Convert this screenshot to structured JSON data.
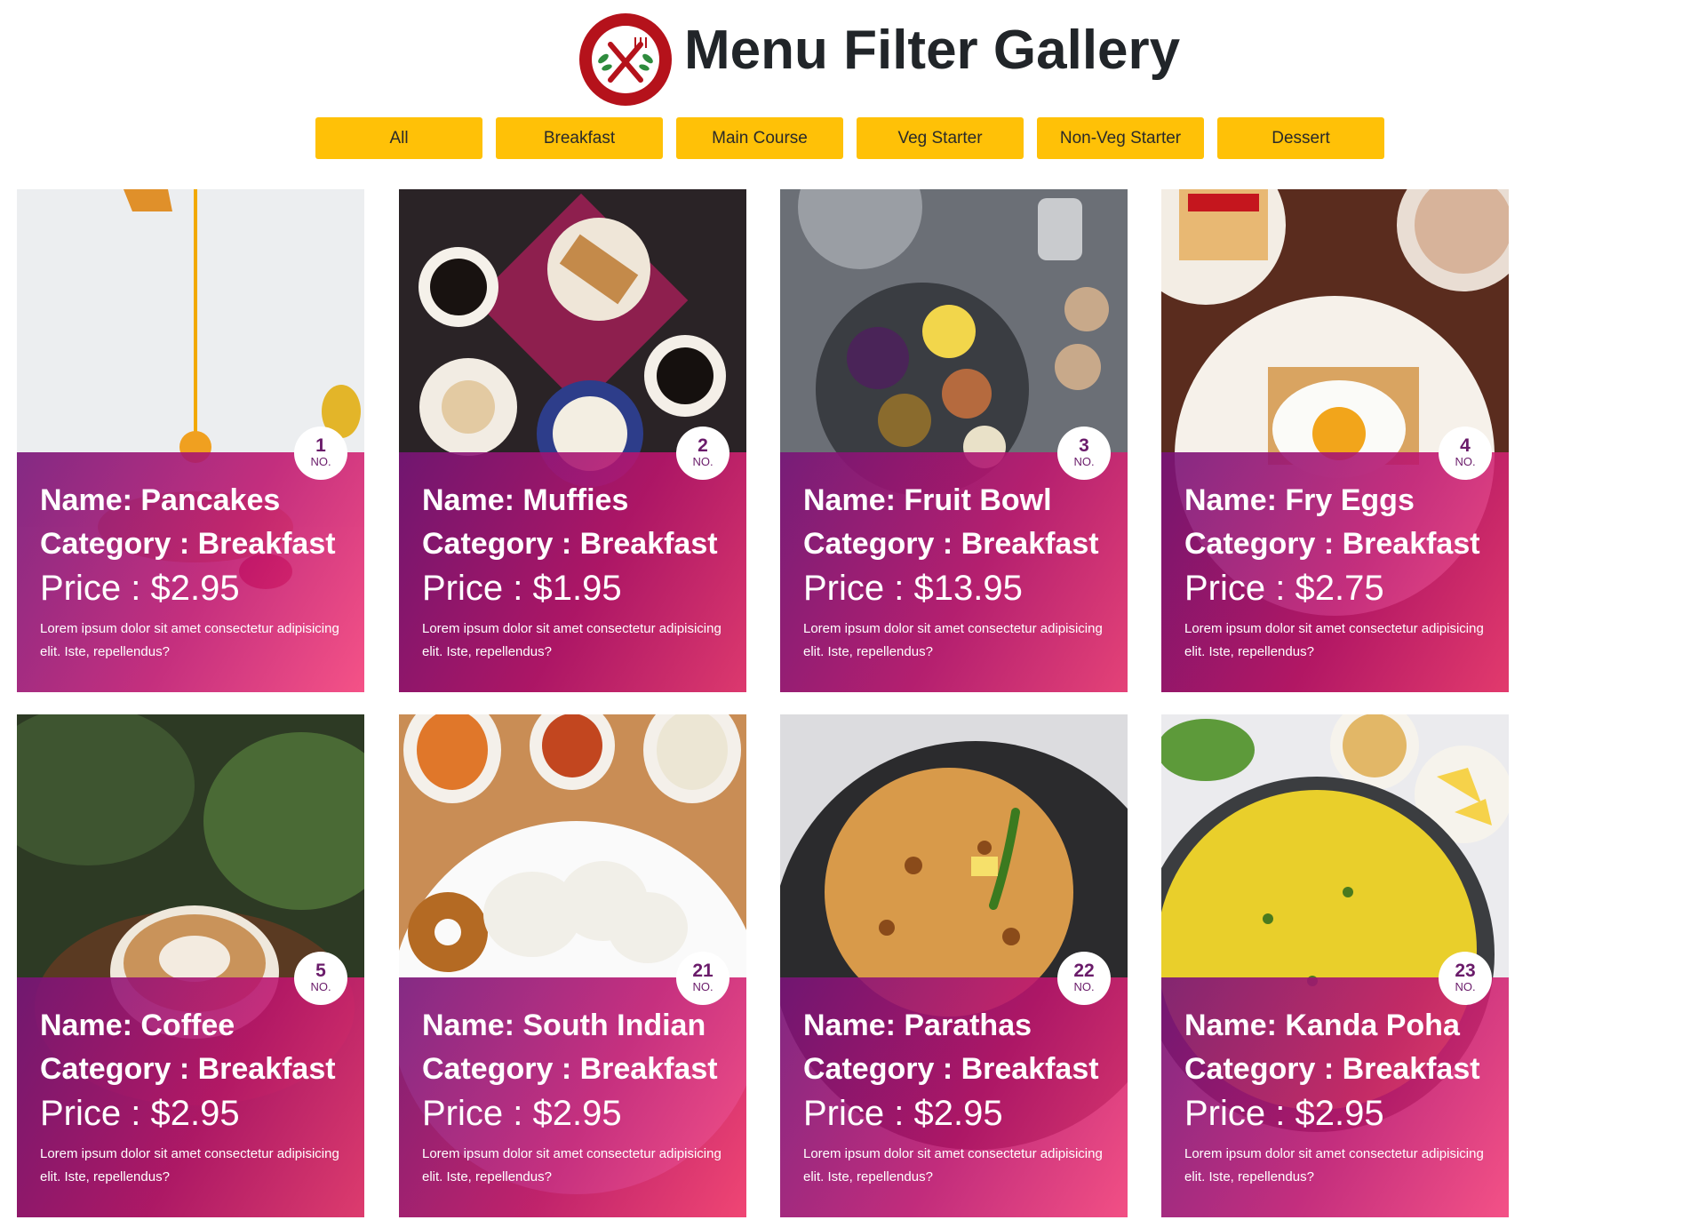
{
  "header": {
    "title": "Menu Filter Gallery",
    "logo_icon": "restaurant-logo-icon"
  },
  "filters": [
    {
      "label": "All"
    },
    {
      "label": "Breakfast"
    },
    {
      "label": "Main Course"
    },
    {
      "label": "Veg Starter"
    },
    {
      "label": "Non-Veg Starter"
    },
    {
      "label": "Dessert"
    }
  ],
  "labels": {
    "name_prefix": "Name: ",
    "category_prefix": "Category : ",
    "price_prefix": "Price : ",
    "badge_suffix": "NO."
  },
  "colors": {
    "accent": "#ffc107",
    "logo_red": "#b5121b",
    "overlay_start": "#7a147a",
    "overlay_end": "#f53c78",
    "badge_text": "#6a1b6a"
  },
  "cards": [
    {
      "number": "1",
      "name": "Pancakes",
      "category": "Breakfast",
      "price": "$2.95",
      "description": "Lorem ipsum dolor sit amet consectetur adipisicing elit. Iste, repellendus?",
      "image_icon": "pancakes-honey-image"
    },
    {
      "number": "2",
      "name": "Muffies",
      "category": "Breakfast",
      "price": "$1.95",
      "description": "Lorem ipsum dolor sit amet consectetur adipisicing elit. Iste, repellendus?",
      "image_icon": "coffee-cake-image"
    },
    {
      "number": "3",
      "name": "Fruit Bowl",
      "category": "Breakfast",
      "price": "$13.95",
      "description": "Lorem ipsum dolor sit amet consectetur adipisicing elit. Iste, repellendus?",
      "image_icon": "fruit-platter-image"
    },
    {
      "number": "4",
      "name": "Fry Eggs",
      "category": "Breakfast",
      "price": "$2.75",
      "description": "Lorem ipsum dolor sit amet consectetur adipisicing elit. Iste, repellendus?",
      "image_icon": "fried-egg-toast-image"
    },
    {
      "number": "5",
      "name": "Coffee",
      "category": "Breakfast",
      "price": "$2.95",
      "description": "Lorem ipsum dolor sit amet consectetur adipisicing elit. Iste, repellendus?",
      "image_icon": "latte-cup-image"
    },
    {
      "number": "21",
      "name": "South Indian",
      "category": "Breakfast",
      "price": "$2.95",
      "description": "Lorem ipsum dolor sit amet consectetur adipisicing elit. Iste, repellendus?",
      "image_icon": "idli-vada-image"
    },
    {
      "number": "22",
      "name": "Parathas",
      "category": "Breakfast",
      "price": "$2.95",
      "description": "Lorem ipsum dolor sit amet consectetur adipisicing elit. Iste, repellendus?",
      "image_icon": "paratha-image"
    },
    {
      "number": "23",
      "name": "Kanda Poha",
      "category": "Breakfast",
      "price": "$2.95",
      "description": "Lorem ipsum dolor sit amet consectetur adipisicing elit. Iste, repellendus?",
      "image_icon": "poha-image"
    }
  ]
}
